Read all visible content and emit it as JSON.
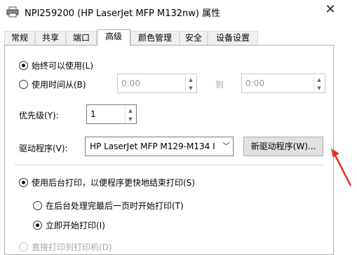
{
  "window": {
    "title": "NPI259200 (HP LaserJet MFP M132nw) 属性",
    "icon": "printer-icon",
    "close_glyph": "✕"
  },
  "tabs": [
    {
      "label": "常规",
      "active": false
    },
    {
      "label": "共享",
      "active": false
    },
    {
      "label": "端口",
      "active": false
    },
    {
      "label": "高级",
      "active": true
    },
    {
      "label": "颜色管理",
      "active": false
    },
    {
      "label": "安全",
      "active": false
    },
    {
      "label": "设备设置",
      "active": false
    }
  ],
  "availability": {
    "always_label": "始终可以使用(L)",
    "always_checked": true,
    "time_label": "使用时间从(B)",
    "time_checked": false,
    "from_value": "0:00",
    "to_label": "到",
    "to_value": "0:00"
  },
  "priority": {
    "label": "优先级(Y):",
    "value": "1"
  },
  "driver": {
    "label": "驱动程序(V):",
    "selected": "HP LaserJet MFP M129-M134 I",
    "new_button": "新驱动程序(W)..."
  },
  "spool": {
    "spool_label": "使用后台打印，以便程序更快地结束打印(S)",
    "spool_checked": true,
    "after_last_page_label": "在后台处理完最后一页时开始打印(T)",
    "after_last_page_checked": false,
    "immediate_label": "立即开始打印(I)",
    "immediate_checked": true,
    "direct_label": "直接打印到打印机(D)",
    "direct_checked": false
  },
  "colors": {
    "annotation_arrow": "#e0312b",
    "tab_active_bg": "#ffffff",
    "button_bg": "#e1e1e1"
  }
}
